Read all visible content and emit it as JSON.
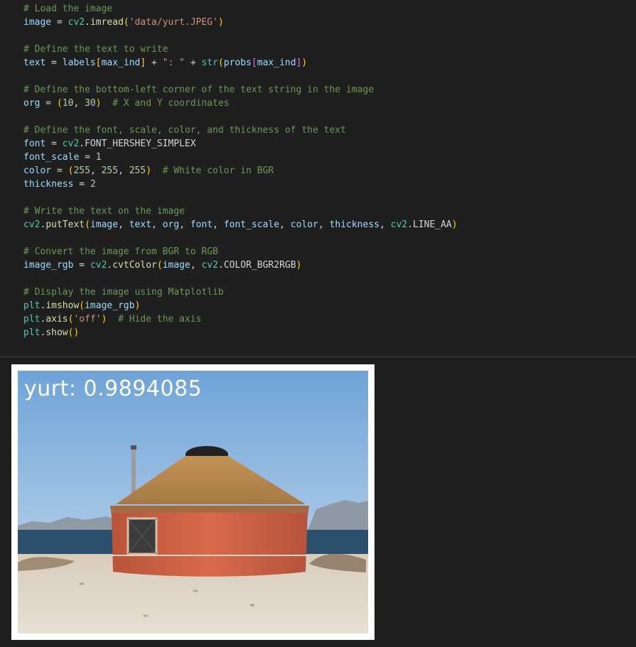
{
  "code_cell": {
    "lines": [
      [
        {
          "t": "# Load the image",
          "c": "comment"
        }
      ],
      [
        {
          "t": "image",
          "c": "var"
        },
        {
          "t": " = ",
          "c": "op"
        },
        {
          "t": "cv2",
          "c": "mod"
        },
        {
          "t": ".",
          "c": "op"
        },
        {
          "t": "imread",
          "c": "fn"
        },
        {
          "t": "(",
          "c": "brk"
        },
        {
          "t": "'data/yurt.JPEG'",
          "c": "str"
        },
        {
          "t": ")",
          "c": "brk"
        }
      ],
      [],
      [
        {
          "t": "# Define the text to write",
          "c": "comment"
        }
      ],
      [
        {
          "t": "text",
          "c": "var"
        },
        {
          "t": " = ",
          "c": "op"
        },
        {
          "t": "labels",
          "c": "var"
        },
        {
          "t": "[",
          "c": "brk"
        },
        {
          "t": "max_ind",
          "c": "var"
        },
        {
          "t": "]",
          "c": "brk"
        },
        {
          "t": " + ",
          "c": "op"
        },
        {
          "t": "\": \"",
          "c": "str"
        },
        {
          "t": " + ",
          "c": "op"
        },
        {
          "t": "str",
          "c": "mod"
        },
        {
          "t": "(",
          "c": "brk"
        },
        {
          "t": "probs",
          "c": "var"
        },
        {
          "t": "[",
          "c": "brk2"
        },
        {
          "t": "max_ind",
          "c": "var"
        },
        {
          "t": "]",
          "c": "brk2"
        },
        {
          "t": ")",
          "c": "brk"
        }
      ],
      [],
      [
        {
          "t": "# Define the bottom-left corner of the text string in the image",
          "c": "comment"
        }
      ],
      [
        {
          "t": "org",
          "c": "var"
        },
        {
          "t": " = ",
          "c": "op"
        },
        {
          "t": "(",
          "c": "brk"
        },
        {
          "t": "10",
          "c": "num"
        },
        {
          "t": ", ",
          "c": "op"
        },
        {
          "t": "30",
          "c": "num"
        },
        {
          "t": ")",
          "c": "brk"
        },
        {
          "t": "  ",
          "c": "op"
        },
        {
          "t": "# X and Y coordinates",
          "c": "comment"
        }
      ],
      [],
      [
        {
          "t": "# Define the font, scale, color, and thickness of the text",
          "c": "comment"
        }
      ],
      [
        {
          "t": "font",
          "c": "var"
        },
        {
          "t": " = ",
          "c": "op"
        },
        {
          "t": "cv2",
          "c": "mod"
        },
        {
          "t": ".",
          "c": "op"
        },
        {
          "t": "FONT_HERSHEY_SIMPLEX",
          "c": "op"
        }
      ],
      [
        {
          "t": "font_scale",
          "c": "var"
        },
        {
          "t": " = ",
          "c": "op"
        },
        {
          "t": "1",
          "c": "num"
        }
      ],
      [
        {
          "t": "color",
          "c": "var"
        },
        {
          "t": " = ",
          "c": "op"
        },
        {
          "t": "(",
          "c": "brk"
        },
        {
          "t": "255",
          "c": "num"
        },
        {
          "t": ", ",
          "c": "op"
        },
        {
          "t": "255",
          "c": "num"
        },
        {
          "t": ", ",
          "c": "op"
        },
        {
          "t": "255",
          "c": "num"
        },
        {
          "t": ")",
          "c": "brk"
        },
        {
          "t": "  ",
          "c": "op"
        },
        {
          "t": "# White color in BGR",
          "c": "comment"
        }
      ],
      [
        {
          "t": "thickness",
          "c": "var"
        },
        {
          "t": " = ",
          "c": "op"
        },
        {
          "t": "2",
          "c": "num"
        }
      ],
      [],
      [
        {
          "t": "# Write the text on the image",
          "c": "comment"
        }
      ],
      [
        {
          "t": "cv2",
          "c": "mod"
        },
        {
          "t": ".",
          "c": "op"
        },
        {
          "t": "putText",
          "c": "fn"
        },
        {
          "t": "(",
          "c": "brk"
        },
        {
          "t": "image",
          "c": "var"
        },
        {
          "t": ", ",
          "c": "op"
        },
        {
          "t": "text",
          "c": "var"
        },
        {
          "t": ", ",
          "c": "op"
        },
        {
          "t": "org",
          "c": "var"
        },
        {
          "t": ", ",
          "c": "op"
        },
        {
          "t": "font",
          "c": "var"
        },
        {
          "t": ", ",
          "c": "op"
        },
        {
          "t": "font_scale",
          "c": "var"
        },
        {
          "t": ", ",
          "c": "op"
        },
        {
          "t": "color",
          "c": "var"
        },
        {
          "t": ", ",
          "c": "op"
        },
        {
          "t": "thickness",
          "c": "var"
        },
        {
          "t": ", ",
          "c": "op"
        },
        {
          "t": "cv2",
          "c": "mod"
        },
        {
          "t": ".",
          "c": "op"
        },
        {
          "t": "LINE_AA",
          "c": "op"
        },
        {
          "t": ")",
          "c": "brk"
        }
      ],
      [],
      [
        {
          "t": "# Convert the image from BGR to RGB",
          "c": "comment"
        }
      ],
      [
        {
          "t": "image_rgb",
          "c": "var"
        },
        {
          "t": " = ",
          "c": "op"
        },
        {
          "t": "cv2",
          "c": "mod"
        },
        {
          "t": ".",
          "c": "op"
        },
        {
          "t": "cvtColor",
          "c": "fn"
        },
        {
          "t": "(",
          "c": "brk"
        },
        {
          "t": "image",
          "c": "var"
        },
        {
          "t": ", ",
          "c": "op"
        },
        {
          "t": "cv2",
          "c": "mod"
        },
        {
          "t": ".",
          "c": "op"
        },
        {
          "t": "COLOR_BGR2RGB",
          "c": "op"
        },
        {
          "t": ")",
          "c": "brk"
        }
      ],
      [],
      [
        {
          "t": "# Display the image using Matplotlib",
          "c": "comment"
        }
      ],
      [
        {
          "t": "plt",
          "c": "mod"
        },
        {
          "t": ".",
          "c": "op"
        },
        {
          "t": "imshow",
          "c": "fn"
        },
        {
          "t": "(",
          "c": "brk"
        },
        {
          "t": "image_rgb",
          "c": "var"
        },
        {
          "t": ")",
          "c": "brk"
        }
      ],
      [
        {
          "t": "plt",
          "c": "mod"
        },
        {
          "t": ".",
          "c": "op"
        },
        {
          "t": "axis",
          "c": "fn"
        },
        {
          "t": "(",
          "c": "brk"
        },
        {
          "t": "'off'",
          "c": "str"
        },
        {
          "t": ")",
          "c": "brk"
        },
        {
          "t": "  ",
          "c": "op"
        },
        {
          "t": "# Hide the axis",
          "c": "comment"
        }
      ],
      [
        {
          "t": "plt",
          "c": "mod"
        },
        {
          "t": ".",
          "c": "op"
        },
        {
          "t": "show",
          "c": "fn"
        },
        {
          "t": "(",
          "c": "brk"
        },
        {
          "t": ")",
          "c": "brk"
        }
      ]
    ]
  },
  "output": {
    "overlay_text": "yurt: 0.9894085",
    "image_subject": "yurt"
  },
  "colors": {
    "background": "#1f1f1f",
    "comment": "#6a9955",
    "variable": "#9cdcfe",
    "function": "#dcdcaa",
    "string": "#ce9178",
    "number": "#b5cea8",
    "module": "#4ec9b0",
    "bracket": "#ffd700"
  }
}
